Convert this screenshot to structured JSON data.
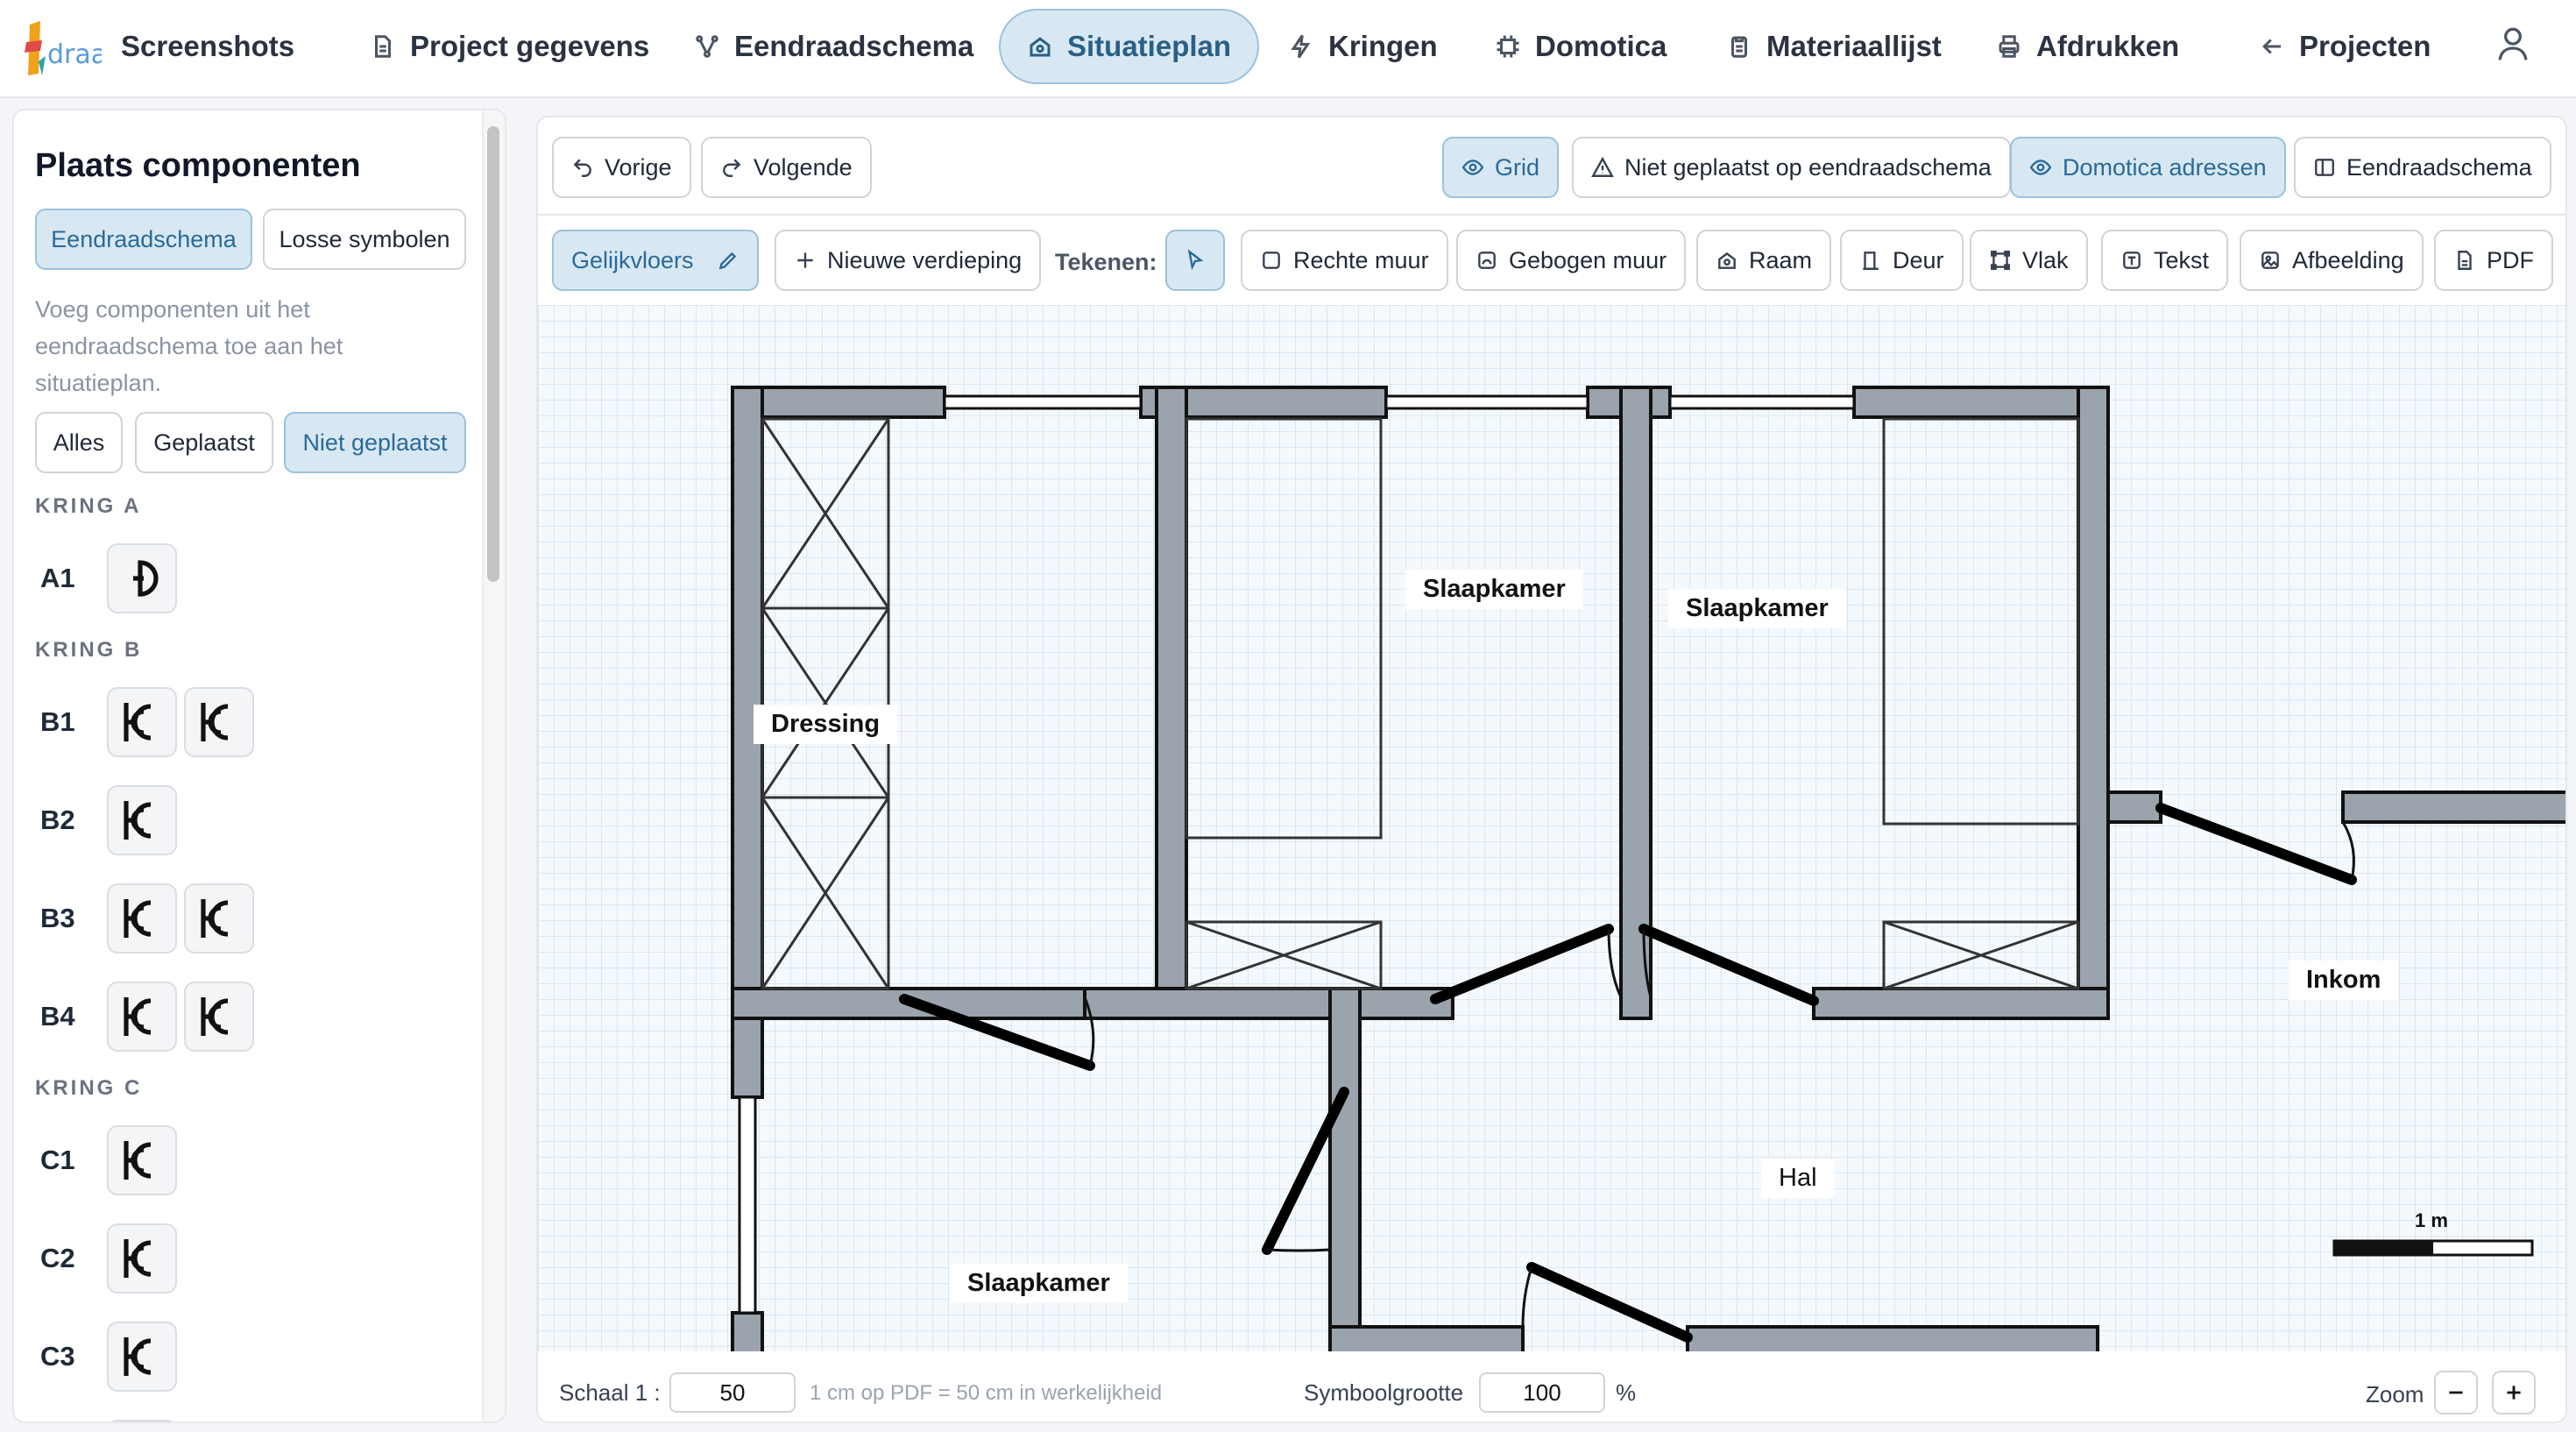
{
  "nav": {
    "brand": "Screenshots",
    "items": [
      {
        "id": "project",
        "label": "Project gegevens",
        "icon": "document-icon"
      },
      {
        "id": "eendraad",
        "label": "Eendraadschema",
        "icon": "branch-icon"
      },
      {
        "id": "situatie",
        "label": "Situatieplan",
        "icon": "home-icon",
        "active": true
      },
      {
        "id": "kringen",
        "label": "Kringen",
        "icon": "bolt-icon"
      },
      {
        "id": "domotica",
        "label": "Domotica",
        "icon": "chip-icon"
      },
      {
        "id": "materiaal",
        "label": "Materiaallijst",
        "icon": "clipboard-icon"
      },
      {
        "id": "afdrukken",
        "label": "Afdrukken",
        "icon": "printer-icon"
      },
      {
        "id": "projecten",
        "label": "Projecten",
        "icon": "arrow-left-icon"
      }
    ]
  },
  "sidebar": {
    "title": "Plaats componenten",
    "source_tabs": [
      "Eendraadschema",
      "Losse symbolen"
    ],
    "description": "Voeg componenten uit het eendraadschema toe aan het situatieplan.",
    "filters": [
      "Alles",
      "Geplaatst",
      "Niet geplaatst"
    ],
    "groups": [
      {
        "title": "KRING A",
        "rows": [
          {
            "label": "A1",
            "symbols": [
              "switch-symbol-icon"
            ]
          }
        ]
      },
      {
        "title": "KRING B",
        "rows": [
          {
            "label": "B1",
            "symbols": [
              "socket-symbol-icon",
              "socket-symbol-icon"
            ]
          },
          {
            "label": "B2",
            "symbols": [
              "socket-symbol-icon"
            ]
          },
          {
            "label": "B3",
            "symbols": [
              "socket-symbol-icon",
              "socket-symbol-icon"
            ]
          },
          {
            "label": "B4",
            "symbols": [
              "socket-symbol-icon",
              "socket-symbol-icon"
            ]
          }
        ]
      },
      {
        "title": "KRING C",
        "rows": [
          {
            "label": "C1",
            "symbols": [
              "socket-symbol-icon"
            ]
          },
          {
            "label": "C2",
            "symbols": [
              "socket-symbol-icon"
            ]
          },
          {
            "label": "C3",
            "symbols": [
              "socket-symbol-icon"
            ]
          }
        ]
      }
    ]
  },
  "toolbar": {
    "prev": "Vorige",
    "next": "Volgende",
    "grid": "Grid",
    "not_placed": "Niet geplaatst op eendraadschema",
    "domotica_addresses": "Domotica adressen",
    "eendraadschema": "Eendraadschema"
  },
  "drawbar": {
    "floor": "Gelijkvloers",
    "new_floor": "Nieuwe verdieping",
    "draw_label": "Tekenen:",
    "tools": [
      "Rechte muur",
      "Gebogen muur",
      "Raam",
      "Deur",
      "Vlak",
      "Tekst",
      "Afbeelding",
      "PDF"
    ]
  },
  "plan": {
    "rooms": [
      "Dressing",
      "Slaapkamer",
      "Slaapkamer",
      "Inkom",
      "Hal",
      "Slaapkamer"
    ],
    "scale_bar_label": "1 m"
  },
  "bottombar": {
    "scale_label": "Schaal 1 :",
    "scale_value": "50",
    "scale_hint": "1 cm op PDF = 50 cm in werkelijkheid",
    "symbol_size_label": "Symboolgrootte",
    "symbol_size_value": "100",
    "symbol_size_unit": "%",
    "zoom_label": "Zoom"
  },
  "colors": {
    "accent_bg": "#d7e8f3",
    "accent_border": "#9cc2db",
    "accent_text": "#2a6a98",
    "wall": "#9ba3ad"
  }
}
